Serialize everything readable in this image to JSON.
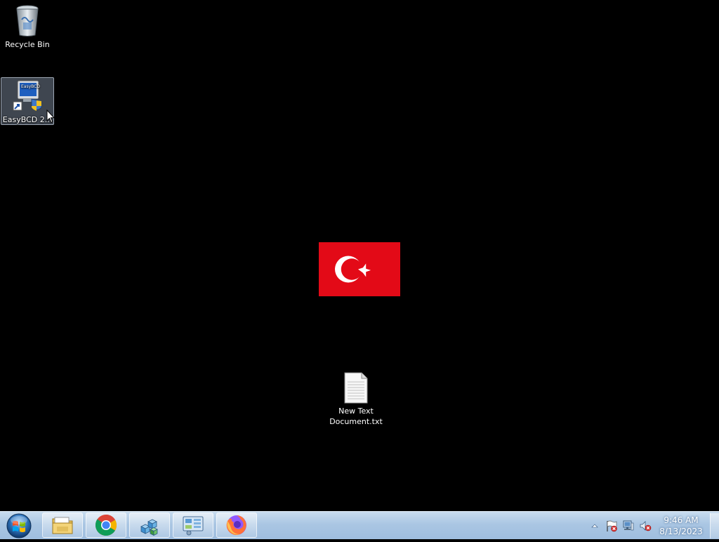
{
  "desktop": {
    "icons": [
      {
        "label": "Recycle Bin",
        "icon": "recycle-bin-icon"
      },
      {
        "label": "EasyBCD 2...",
        "icon": "easybcd-icon"
      },
      {
        "label": "New Text\nDocument.txt",
        "icon": "text-document-icon"
      }
    ],
    "wallpaper": {
      "background": "#000000",
      "flag_red": "#e30a17",
      "flag_white": "#ffffff"
    }
  },
  "taskbar": {
    "start_icon": "windows-start-orb",
    "pinned": [
      {
        "icon": "file-explorer-icon",
        "name": "Windows Explorer"
      },
      {
        "icon": "chrome-icon",
        "name": "Google Chrome"
      },
      {
        "icon": "registry-cubes-icon",
        "name": "Registry"
      },
      {
        "icon": "control-panel-icon",
        "name": "Control Panel"
      },
      {
        "icon": "firefox-icon",
        "name": "Firefox"
      }
    ],
    "tray": {
      "show_hidden_icon": "chevron-up-icon",
      "icons": [
        "action-center-flag-icon",
        "network-icon",
        "volume-muted-icon"
      ],
      "time": "9:46 AM",
      "date": "8/13/2023"
    }
  }
}
